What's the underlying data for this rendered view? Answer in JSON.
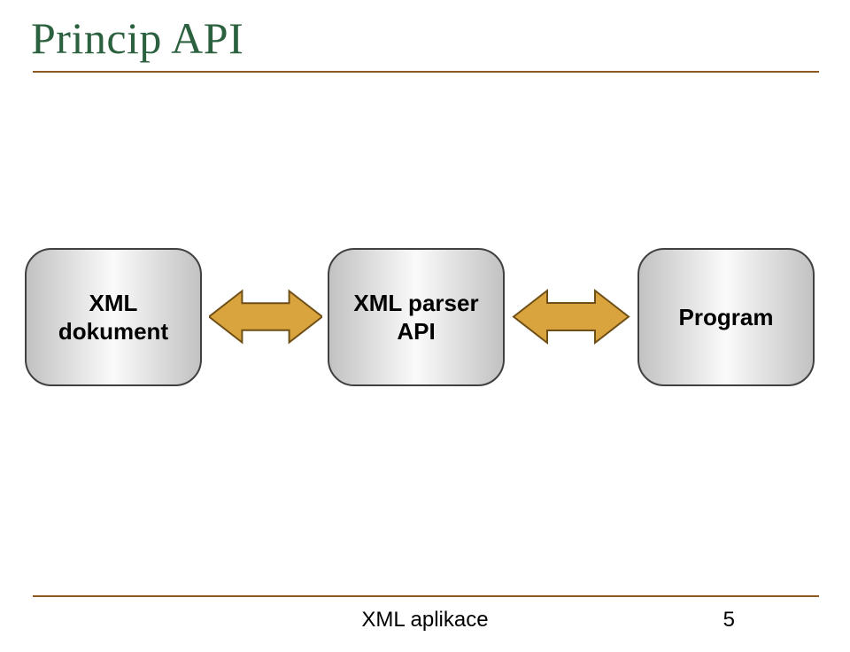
{
  "title": "Princip API",
  "boxes": {
    "b1": {
      "name": "xml-document-box",
      "lines": [
        "XML dokument"
      ]
    },
    "b2": {
      "name": "xml-parser-api-box",
      "lines": [
        "XML parser",
        "API"
      ]
    },
    "b3": {
      "name": "program-box",
      "lines": [
        "Program"
      ]
    }
  },
  "arrows": {
    "a1": "arrow-doc-parser",
    "a2": "arrow-parser-program"
  },
  "footer": {
    "label": "XML aplikace",
    "page": "5"
  },
  "colors": {
    "title": "#2c6140",
    "rule": "#8f5a22",
    "arrow_fill": "#d9a33d",
    "arrow_stroke": "#6e4f17"
  }
}
